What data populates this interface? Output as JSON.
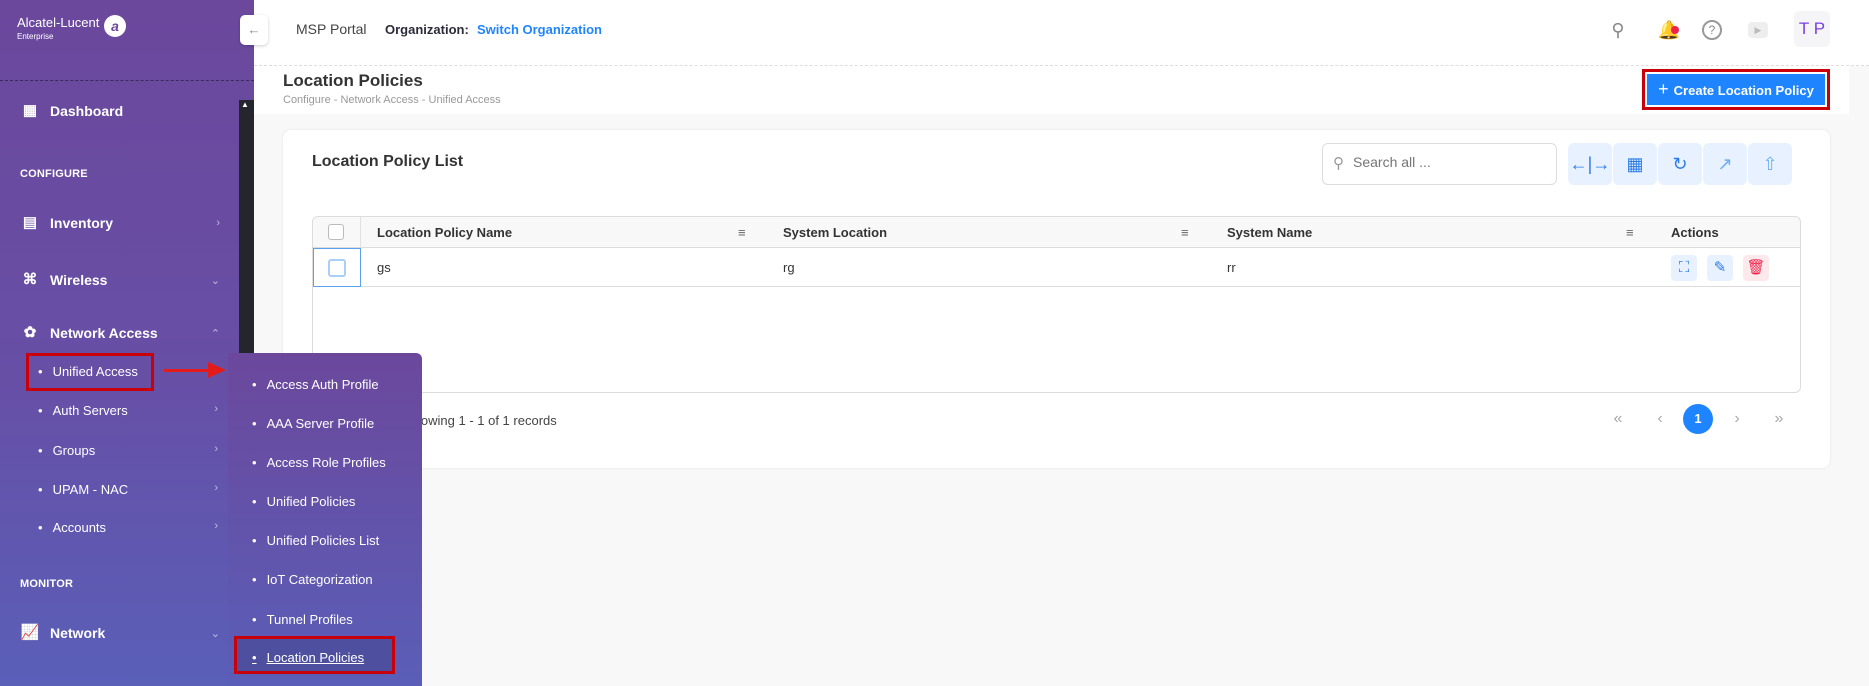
{
  "brand": {
    "name": "Alcatel-Lucent",
    "sub": "Enterprise"
  },
  "sidebar": {
    "dashboard": "Dashboard",
    "configure": "CONFIGURE",
    "inventory": "Inventory",
    "wireless": "Wireless",
    "network_access": "Network Access",
    "sub_items": [
      "Unified Access",
      "Auth Servers",
      "Groups",
      "UPAM - NAC",
      "Accounts"
    ],
    "monitor": "MONITOR",
    "network": "Network"
  },
  "flyout": {
    "items": [
      "Access Auth Profile",
      "AAA Server Profile",
      "Access Role Profiles",
      "Unified Policies",
      "Unified Policies List",
      "IoT Categorization",
      "Tunnel Profiles",
      "Location Policies"
    ],
    "active": "Location Policies"
  },
  "topbar": {
    "portal": "MSP Portal",
    "org_label": "Organization:",
    "org_link": "Switch Organization",
    "avatar": "T P",
    "icons": [
      "search-icon",
      "bell-icon",
      "help-icon",
      "video-icon"
    ]
  },
  "page": {
    "title": "Location Policies",
    "breadcrumb": [
      "Configure",
      "Network Access",
      "Unified Access"
    ],
    "create_button": "Create Location Policy"
  },
  "card": {
    "title": "Location Policy List",
    "search_placeholder": "Search all ...",
    "toolbar": [
      "resize-columns-icon",
      "columns-icon",
      "refresh-icon",
      "export-icon",
      "upload-icon"
    ]
  },
  "table": {
    "columns": [
      "Location Policy Name",
      "System Location",
      "System Name",
      "Actions"
    ],
    "rows": [
      {
        "name": "gs",
        "location": "rg",
        "system_name": "rr"
      }
    ]
  },
  "pagination": {
    "summary": "Showing 1 - 1 of 1 records",
    "current": "1"
  },
  "colors": {
    "accent": "#1f84ff",
    "highlight": "#c9000a",
    "sidebar": "#6b489c"
  }
}
